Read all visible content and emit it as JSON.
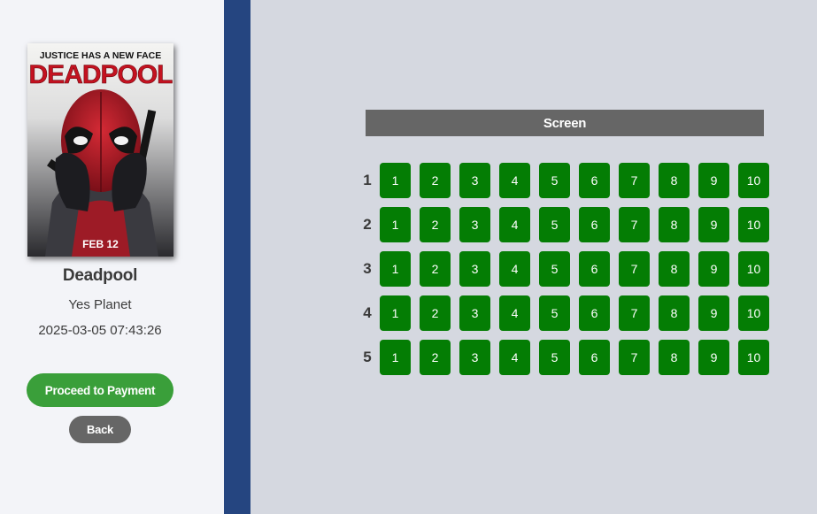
{
  "poster": {
    "tagline": "JUSTICE HAS A NEW FACE",
    "title_art": "DEADPOOL",
    "date_art": "FEB 12"
  },
  "movie": {
    "title": "Deadpool",
    "theater": "Yes Planet",
    "showtime": "2025-03-05 07:43:26"
  },
  "actions": {
    "proceed_label": "Proceed to Payment",
    "back_label": "Back"
  },
  "screen_label": "Screen",
  "seating": {
    "rows": [
      "1",
      "2",
      "3",
      "4",
      "5"
    ],
    "seats": [
      "1",
      "2",
      "3",
      "4",
      "5",
      "6",
      "7",
      "8",
      "9",
      "10"
    ],
    "seat_color": "#047d04"
  },
  "colors": {
    "sidebar_bg": "#f3f4f8",
    "divider": "#254580",
    "main_bg": "#d5d8e0",
    "proceed_bg": "#3a9f3a",
    "back_bg": "#666666",
    "screen_bg": "#666666"
  }
}
